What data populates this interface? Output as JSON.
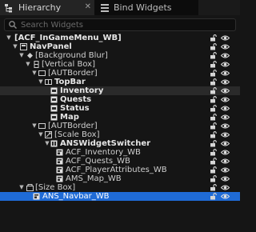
{
  "tabs": [
    {
      "label": "Hierarchy",
      "icon": "hierarchy-icon"
    },
    {
      "label": "Bind Widgets",
      "icon": "bind-widgets-icon"
    }
  ],
  "search": {
    "placeholder": "Search Widgets"
  },
  "tree": [
    {
      "label": "[ACF_InGameMenu_WB]",
      "bold": true,
      "icon": "",
      "arrow": "down"
    },
    {
      "label": "NavPanel",
      "bold": true,
      "icon": "canvas-icon",
      "arrow": "down"
    },
    {
      "label": "[Background Blur]",
      "bold": false,
      "icon": "diamond-icon",
      "arrow": "down"
    },
    {
      "label": "[Vertical Box]",
      "bold": false,
      "icon": "vertical-box-icon",
      "arrow": "down"
    },
    {
      "label": "[AUTBorder]",
      "bold": false,
      "icon": "border-icon",
      "arrow": "down"
    },
    {
      "label": "TopBar",
      "bold": true,
      "icon": "horizontal-box-icon",
      "arrow": "down"
    },
    {
      "label": "Inventory",
      "bold": true,
      "icon": "button-icon",
      "arrow": ""
    },
    {
      "label": "Quests",
      "bold": true,
      "icon": "button-icon",
      "arrow": ""
    },
    {
      "label": "Status",
      "bold": true,
      "icon": "button-icon",
      "arrow": ""
    },
    {
      "label": "Map",
      "bold": true,
      "icon": "button-icon",
      "arrow": ""
    },
    {
      "label": "[AUTBorder]",
      "bold": false,
      "icon": "border-icon",
      "arrow": "down"
    },
    {
      "label": "[Scale Box]",
      "bold": false,
      "icon": "scale-box-icon",
      "arrow": "down"
    },
    {
      "label": "ANSWidgetSwitcher",
      "bold": true,
      "icon": "switcher-icon",
      "arrow": "down"
    },
    {
      "label": "ACF_Inventory_WB",
      "bold": false,
      "icon": "user-widget-icon",
      "arrow": ""
    },
    {
      "label": "ACF_Quests_WB",
      "bold": false,
      "icon": "user-widget-icon",
      "arrow": ""
    },
    {
      "label": "ACF_PlayerAttributes_WB",
      "bold": false,
      "icon": "user-widget-icon",
      "arrow": ""
    },
    {
      "label": "AMS_Map_WB",
      "bold": false,
      "icon": "user-widget-icon",
      "arrow": ""
    },
    {
      "label": "[Size Box]",
      "bold": false,
      "icon": "size-box-icon",
      "arrow": "down"
    },
    {
      "label": "ANS_Navbar_WB",
      "bold": false,
      "icon": "user-widget-icon",
      "arrow": ""
    }
  ],
  "colors": {
    "background": "#151515",
    "selection": "#1f6bd6",
    "tab_active": "#242424"
  }
}
